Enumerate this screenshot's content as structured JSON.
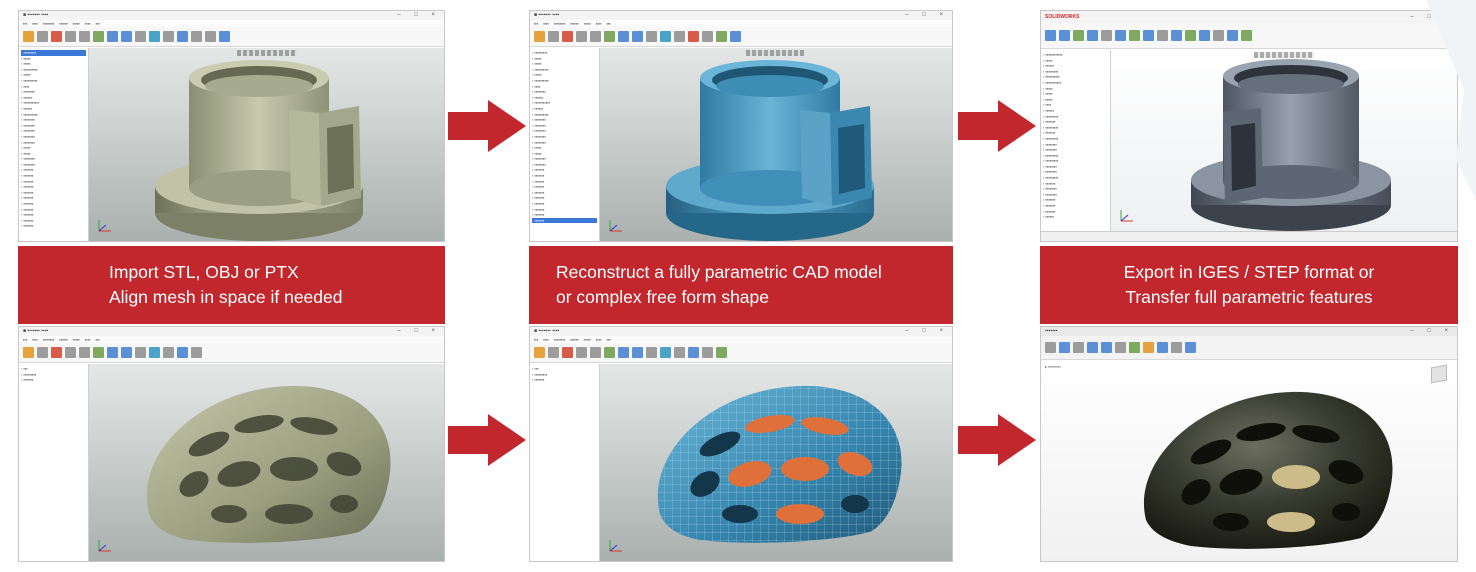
{
  "steps": [
    {
      "line1": "Import  STL, OBJ or PTX",
      "line2": "Align mesh in space if needed"
    },
    {
      "line1": "Reconstruct a fully parametric CAD model",
      "line2": "or complex free form shape"
    },
    {
      "line1": "Export in IGES / STEP format or",
      "line2": "Transfer full parametric features"
    }
  ],
  "software_brand": "SOLIDWORKS",
  "colors": {
    "banner_red": "#c1272d",
    "arrow_red": "#c1272d",
    "mesh_olive": "#a7ab8c",
    "cad_blue": "#3f8fb8",
    "solidworks_gray": "#5d6773",
    "helmet_dark": "#3a3d32"
  },
  "icons": [
    "arrow-right-icon",
    "coordinate-triad-icon",
    "window-controls-icon"
  ]
}
